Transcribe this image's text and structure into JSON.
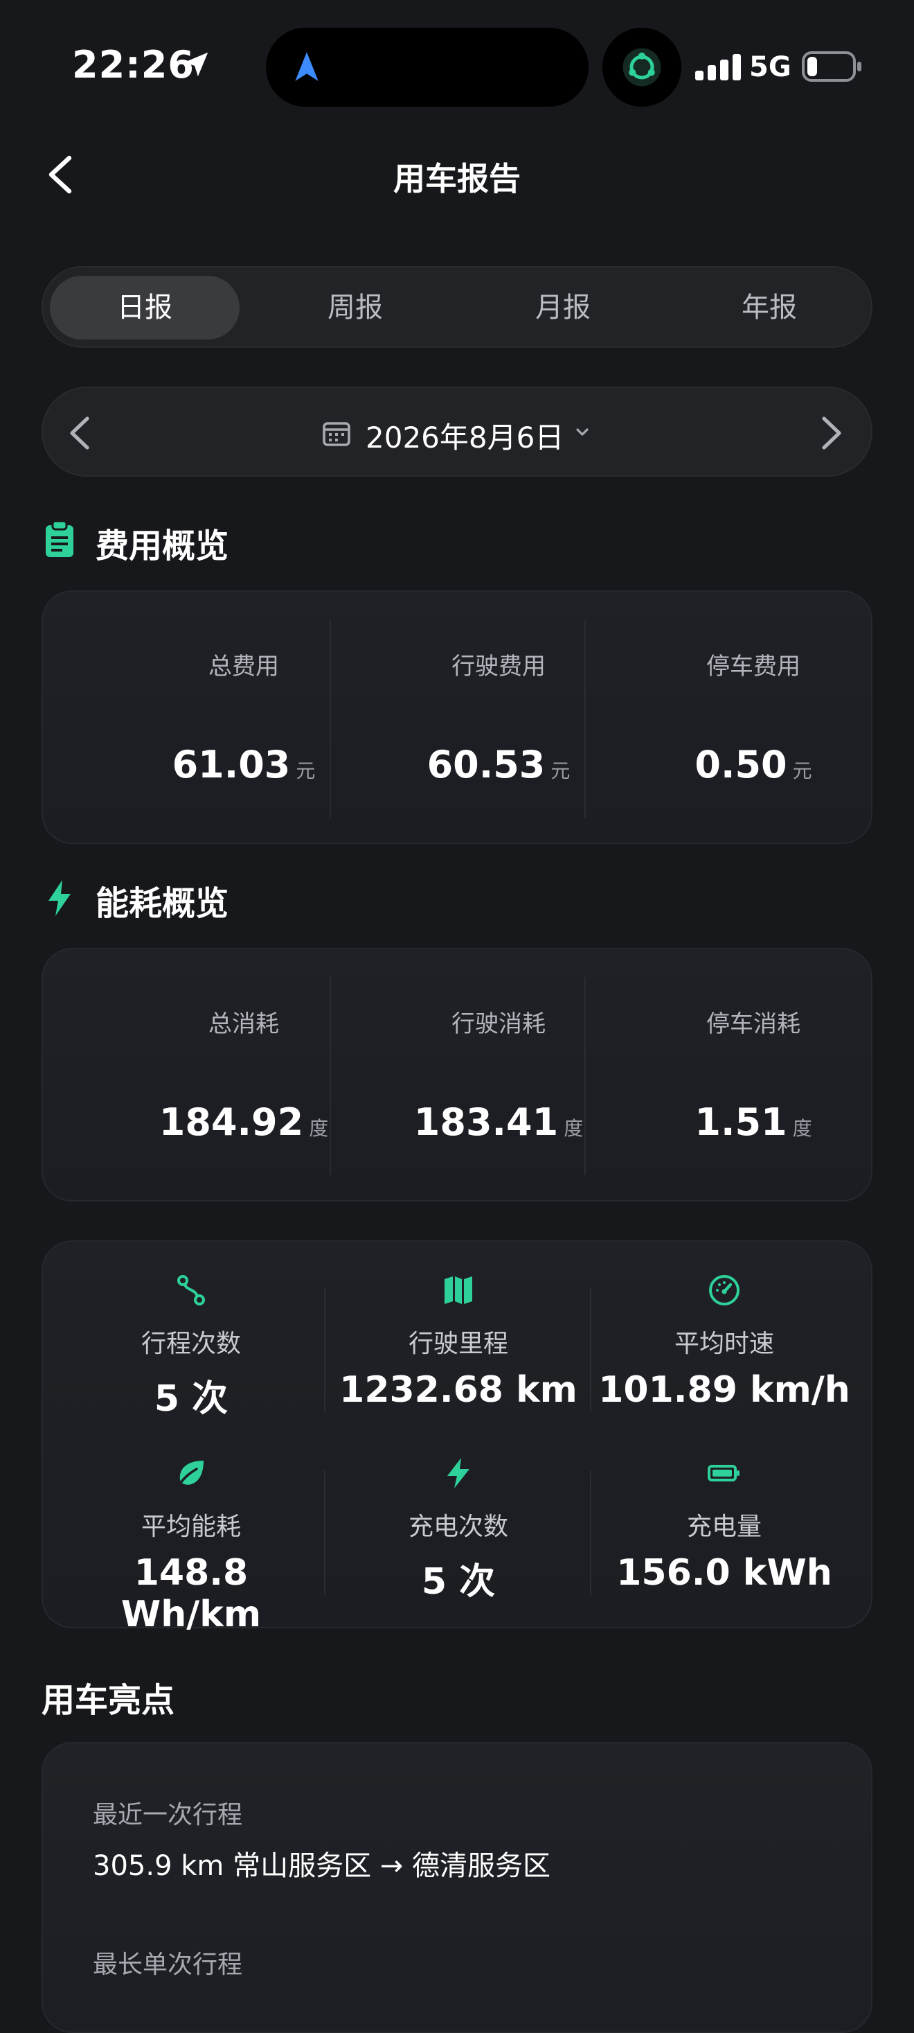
{
  "status_bar": {
    "time": "22:26",
    "network": "5G",
    "icons": [
      "location-arrow-icon",
      "navigation-arrow-icon",
      "app-activity-icon",
      "signal-icon",
      "battery-icon"
    ]
  },
  "header": {
    "title": "用车报告"
  },
  "tabs": [
    {
      "label": "日报",
      "active": true
    },
    {
      "label": "周报",
      "active": false
    },
    {
      "label": "月报",
      "active": false
    },
    {
      "label": "年报",
      "active": false
    }
  ],
  "date_selector": {
    "date": "2026年8月6日"
  },
  "cost_overview": {
    "title": "费用概览",
    "items": [
      {
        "label": "总费用",
        "value": "61.03",
        "unit": "元"
      },
      {
        "label": "行驶费用",
        "value": "60.53",
        "unit": "元"
      },
      {
        "label": "停车费用",
        "value": "0.50",
        "unit": "元"
      }
    ]
  },
  "energy_overview": {
    "title": "能耗概览",
    "items": [
      {
        "label": "总消耗",
        "value": "184.92",
        "unit": "度"
      },
      {
        "label": "行驶消耗",
        "value": "183.41",
        "unit": "度"
      },
      {
        "label": "停车消耗",
        "value": "1.51",
        "unit": "度"
      }
    ]
  },
  "metrics": [
    {
      "icon": "route-icon",
      "label": "行程次数",
      "value": "5 次"
    },
    {
      "icon": "map-icon",
      "label": "行驶里程",
      "value": "1232.68 km"
    },
    {
      "icon": "speedometer-icon",
      "label": "平均时速",
      "value": "101.89 km/h"
    },
    {
      "icon": "leaf-icon",
      "label": "平均能耗",
      "value": "148.8 Wh/km"
    },
    {
      "icon": "bolt-icon",
      "label": "充电次数",
      "value": "5 次"
    },
    {
      "icon": "battery-icon",
      "label": "充电量",
      "value": "156.0 kWh"
    }
  ],
  "highlights": {
    "title": "用车亮点",
    "items": [
      {
        "label": "最近一次行程",
        "value": "305.9 km 常山服务区 → 德清服务区"
      },
      {
        "label": "最长单次行程",
        "value": ""
      }
    ]
  },
  "colors": {
    "background": "#17181b",
    "accent": "#2ed19a",
    "card": "#1f2126"
  }
}
